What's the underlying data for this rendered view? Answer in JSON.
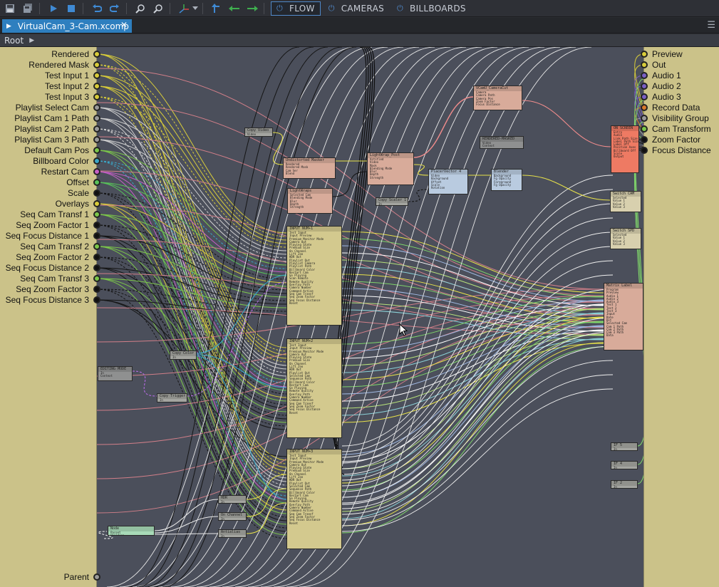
{
  "toolbar": {
    "tabs": [
      {
        "label": "FLOW",
        "active": true
      },
      {
        "label": "CAMERAS",
        "active": false
      },
      {
        "label": "BILLBOARDS",
        "active": false
      }
    ],
    "icons": [
      "save-icon",
      "save-all-icon",
      "play-icon",
      "stop-icon",
      "undo-icon",
      "redo-icon",
      "zoom-in-icon",
      "zoom-out-icon",
      "axis-icon",
      "dropdown-icon",
      "up-arrow-icon",
      "back-arrow-icon",
      "forward-arrow-icon"
    ]
  },
  "file_tab": {
    "name": "VirtualCam_3-Cam.xcomp"
  },
  "breadcrumb": {
    "root": "Root"
  },
  "left_ports": [
    {
      "label": "Rendered",
      "color": "#d8cc3a"
    },
    {
      "label": "Rendered Mask",
      "color": "#d8cc3a"
    },
    {
      "label": "Test Input 1",
      "color": "#d8cc3a"
    },
    {
      "label": "Test Input 2",
      "color": "#d8cc3a"
    },
    {
      "label": "Test Input 3",
      "color": "#d8cc3a"
    },
    {
      "label": "Playlist Select Cam",
      "color": "#9a9a9a"
    },
    {
      "label": "Playlist Cam 1 Path",
      "color": "#9a9a9a"
    },
    {
      "label": "Playlist Cam 2 Path",
      "color": "#9a9a9a"
    },
    {
      "label": "Playlist Cam 3 Path",
      "color": "#9a9a9a"
    },
    {
      "label": "Default Cam Pos",
      "color": "#7cc74a"
    },
    {
      "label": "Billboard Color",
      "color": "#3aa7c8"
    },
    {
      "label": "Restart Cam",
      "color": "#c55fc6"
    },
    {
      "label": "Offset",
      "color": "#58c25a"
    },
    {
      "label": "Scale",
      "color": "#111111"
    },
    {
      "label": "Overlays",
      "color": "#d8cc3a"
    },
    {
      "label": "Seq Cam Transf 1",
      "color": "#7cc74a"
    },
    {
      "label": "Seq Zoom Factor 1",
      "color": "#111111"
    },
    {
      "label": "Seq Focus Distance 1",
      "color": "#111111"
    },
    {
      "label": "Seq Cam Transf 2",
      "color": "#7cc74a"
    },
    {
      "label": "Seq Zoom Factor 2",
      "color": "#111111"
    },
    {
      "label": "Seq Focus Distance 2",
      "color": "#111111"
    },
    {
      "label": "Seq Cam Transf 3",
      "color": "#7cc74a"
    },
    {
      "label": "Seq Zoom Factor 3",
      "color": "#111111"
    },
    {
      "label": "Seq Focus Distance 3",
      "color": "#111111"
    }
  ],
  "parent_port": {
    "label": "Parent",
    "color": "#9a9a9a"
  },
  "right_ports": [
    {
      "label": "Preview",
      "color": "#d8cc3a"
    },
    {
      "label": "Out",
      "color": "#d8cc3a"
    },
    {
      "label": "Audio 1",
      "color": "#7a5fc4"
    },
    {
      "label": "Audio 2",
      "color": "#7a5fc4"
    },
    {
      "label": "Audio 3",
      "color": "#7a5fc4"
    },
    {
      "label": "Record Data",
      "color": "#d9792a"
    },
    {
      "label": "Visibility Group",
      "color": "#9a9a9a"
    },
    {
      "label": "Cam Transform",
      "color": "#7cc74a"
    },
    {
      "label": "Zoom Factor",
      "color": "#111111"
    },
    {
      "label": "Focus Distance",
      "color": "#111111"
    }
  ],
  "nodes": {
    "copy_video": {
      "title": "Copy Video",
      "rows": [
        "Video"
      ]
    },
    "undistorted_masker": {
      "title": "Undistorted Masker",
      "rows": [
        "Rendered",
        "Rendered Mask",
        "Cam Ser",
        "Blend"
      ]
    },
    "lightwrap_post": {
      "title": "LightWrap_Post",
      "rows": [
        "Vstitled",
        "Video",
        "Mask",
        "Blending Mode",
        "Blur",
        "Depth",
        "Strength"
      ]
    },
    "vcamu_cameracut": {
      "title": "VCamU_CameraCut",
      "rows": [
        "Camera",
        "Camera Path",
        "Camera Pos",
        "Zoom Factor",
        "Focus Distance"
      ]
    },
    "render_masked": {
      "title": "RENDERED-MASKED",
      "rows": [
        "Video",
        "Context"
      ]
    },
    "on_screen": {
      "title": "ON SCREEN",
      "rows": [
        "Entry",
        "Audio",
        "Link Path Size",
        "Label Path Size",
        "Label Off",
        "Position Axes",
        "Billboard Off",
        "Scale",
        "Output"
      ]
    },
    "lightwraps": {
      "title": "LightWraps",
      "rows": [
        "Selected Cam",
        "Blending Mode",
        "Blur",
        "Depth",
        "Strength"
      ]
    },
    "copy_scalar": {
      "title": "Copy Scaler 1",
      "rows": [
        "In"
      ]
    },
    "placer_vector": {
      "title": "PlacerVector 4",
      "rows": [
        "Video",
        "Background",
        "Offset",
        "Scale",
        "Rotation"
      ]
    },
    "blender": {
      "title": "Blender",
      "rows": [
        "Background",
        "Fg Opacity",
        "Foreground",
        "Fg Opacity"
      ]
    },
    "switch_cam": {
      "title": "Switch CAM",
      "rows": [
        "Selected",
        "Value 1",
        "Value 2",
        "Value 3"
      ]
    },
    "switch_spd": {
      "title": "Switch SPD",
      "rows": [
        "Selected",
        "Value 1",
        "Value 2",
        "Value 3"
      ]
    },
    "matrix_label": {
      "title": "Matrix Label",
      "rows": [
        "Program",
        "Preview",
        "Audio 1",
        "Audio 2",
        "Audio 3",
        "Test 1",
        "Test 2",
        "Test 3",
        "Input",
        "Rate",
        "Dst",
        "Selected Cam",
        "Cam 1 Path",
        "Cam 2 Path",
        "Cam 3 Path",
        "Data"
      ]
    },
    "input_1": {
      "title": "INPUT NUM+1",
      "rows": [
        "Test Input",
        "Input Preview",
        "Premium Monitor Mode",
        "Camera Out",
        "Playing State",
        "Premium Size",
        "On Channel",
        "Lift Zoo",
        "HDR Out",
        "Playlist Out",
        "Playlist Camera",
        "Playlist Path",
        "Billboard Color",
        "Restart Cam",
        "Go Playing",
        "Scan Remote",
        "Remote Quality",
        "Overlay Path",
        "Camera Number",
        "Command Active",
        "Seq Cam Transf",
        "Seq Zoom Factor",
        "Seq Focus Distance",
        "Reset"
      ]
    },
    "input_2": {
      "title": "INPUT NUM+2",
      "rows": [
        "Test Input",
        "Input Preview",
        "Premium Monitor Mode",
        "Camera Out",
        "Playing State",
        "Premium Size",
        "On Channel",
        "Lift Zoo",
        "HDR Out",
        "Playlist Out",
        "Selected Cam",
        "Sequence Path",
        "Billboard Color",
        "Restart Cam",
        "Go Playing",
        "Remote Quality",
        "Overlay Path",
        "Camera Number",
        "Command Active",
        "Seq Cam Transf",
        "Seq Zoom Factor",
        "Seq Focus Distance",
        "Reset"
      ]
    },
    "input_3": {
      "title": "INPUT NUM+3",
      "rows": [
        "Test Input",
        "Input Preview",
        "Premium Monitor Mode",
        "Camera Out",
        "Playing State",
        "Premium Size",
        "On Channel",
        "Lift Zoo",
        "HDR Out",
        "Playlist Out",
        "Selected Cam",
        "Sequence Path",
        "Billboard Color",
        "Restart Cam",
        "Go Playing",
        "Remote Quality",
        "Overlay Path",
        "Camera Number",
        "Command Active",
        "Seq Cam Transf",
        "Seq Zoom Factor",
        "Seq Focus Distance",
        "Reset"
      ]
    },
    "copy_color": {
      "title": "Copy Color",
      "rows": [
        "In"
      ]
    },
    "editing_mode": {
      "title": "EDITING MODE",
      "rows": [
        "In",
        "Context"
      ]
    },
    "copy_trigger": {
      "title": "Copy Trigger",
      "rows": [
        "In"
      ]
    },
    "hdr": {
      "title": "HDR",
      "rows": [
        "In"
      ]
    },
    "on_channel": {
      "title": "On Channel",
      "rows": [
        "In"
      ]
    },
    "antialias": {
      "title": "Antialias",
      "rows": [
        "In"
      ]
    },
    "node_node": {
      "title": "Node",
      "rows": [
        "Parent",
        "Children"
      ]
    },
    "if5": {
      "title": "IF 5",
      "rows": [
        "In"
      ]
    },
    "if4": {
      "title": "IF 4",
      "rows": [
        "In"
      ]
    },
    "if2": {
      "title": "IF 2",
      "rows": [
        "In"
      ]
    }
  }
}
